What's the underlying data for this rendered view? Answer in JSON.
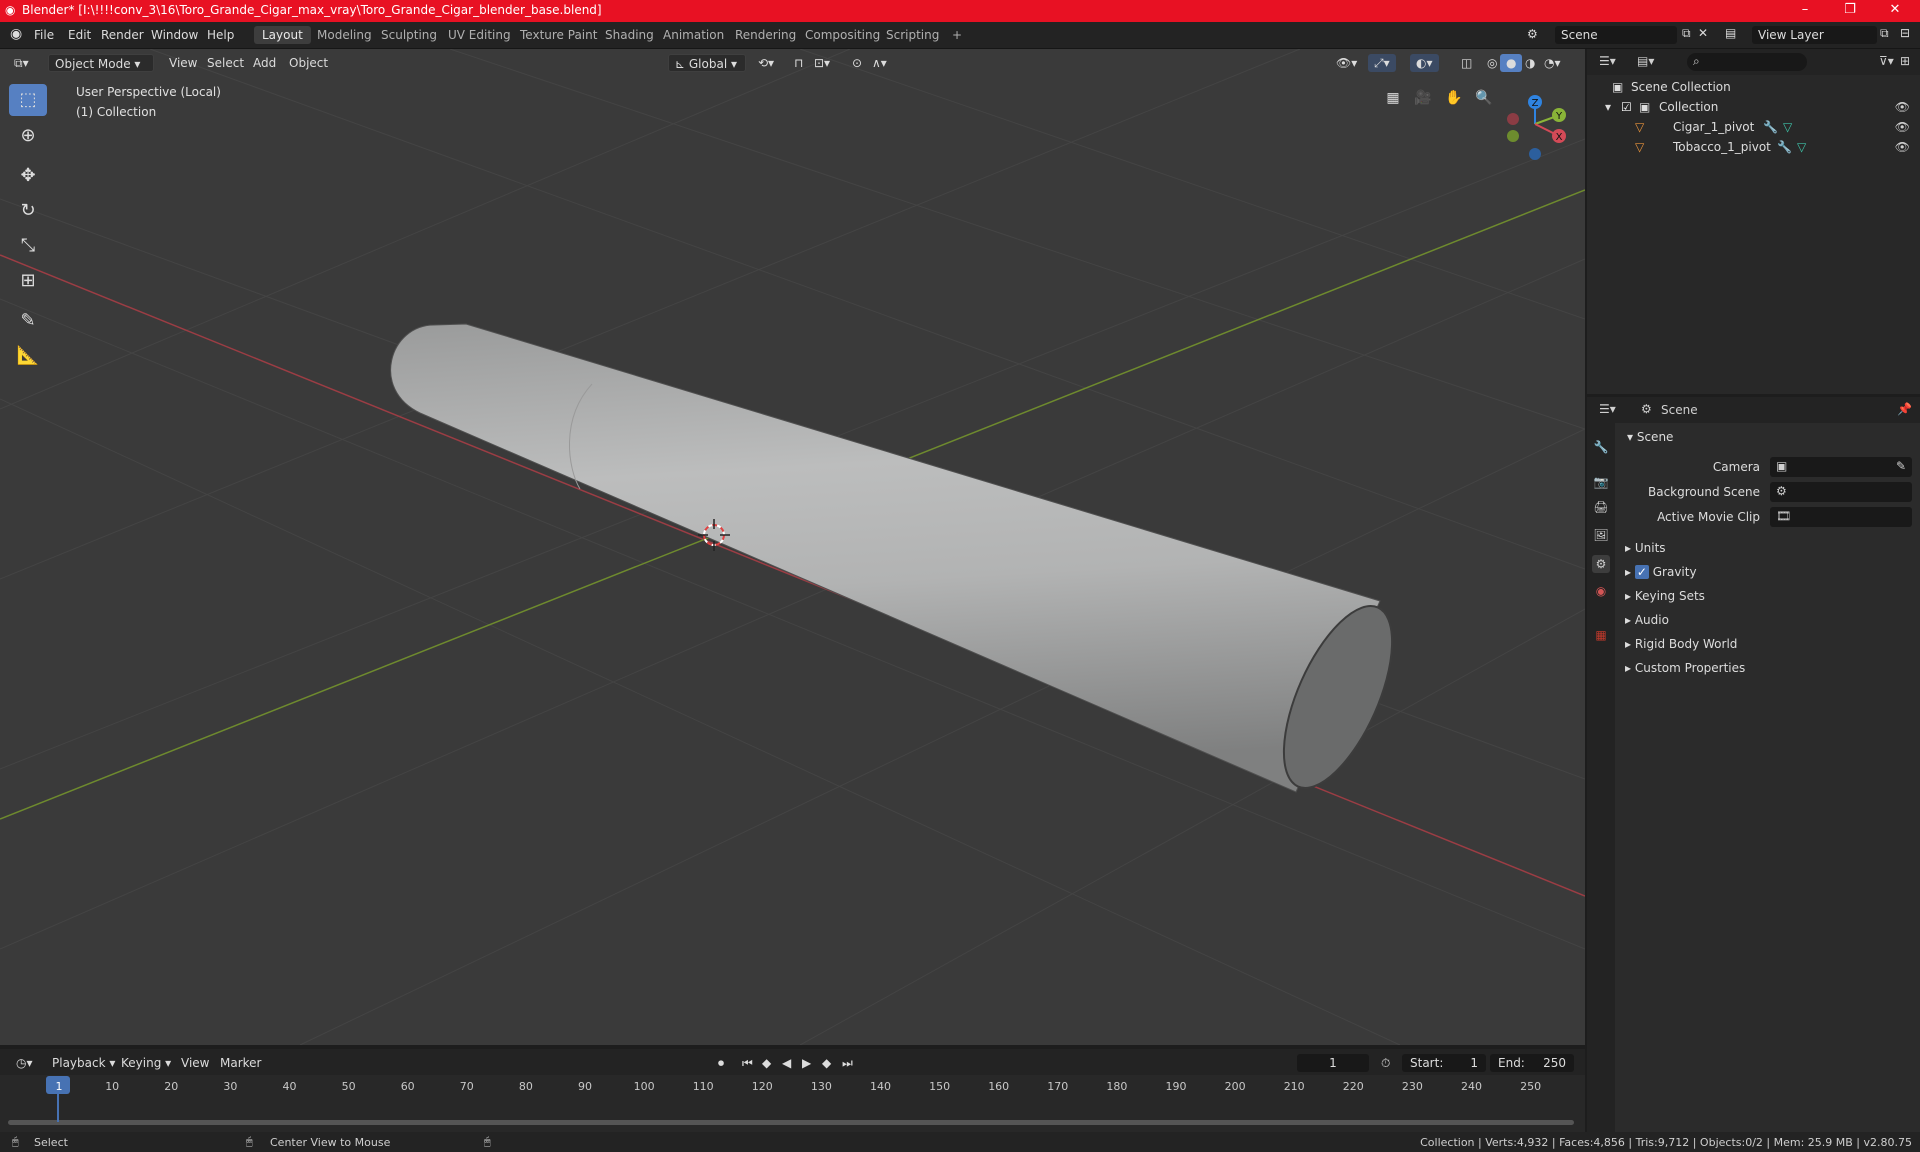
{
  "window": {
    "title": "Blender* [I:\\!!!!conv_3\\16\\Toro_Grande_Cigar_max_vray\\Toro_Grande_Cigar_blender_base.blend]",
    "minimize": "–",
    "maximize": "❐",
    "close": "✕"
  },
  "menu": [
    "File",
    "Edit",
    "Render",
    "Window",
    "Help"
  ],
  "workspaces": [
    "Layout",
    "Modeling",
    "Sculpting",
    "UV Editing",
    "Texture Paint",
    "Shading",
    "Animation",
    "Rendering",
    "Compositing",
    "Scripting"
  ],
  "workspace_add": "+",
  "scene_name": "Scene",
  "view_layer": "View Layer",
  "viewport_header": {
    "mode": "Object Mode",
    "menus": [
      "View",
      "Select",
      "Add",
      "Object"
    ],
    "orientation": "Global"
  },
  "viewport": {
    "perspective": "User Perspective (Local)",
    "collection": "(1) Collection",
    "gizmo": {
      "z": "Z",
      "y": "Y",
      "x": "X"
    }
  },
  "outliner": {
    "root": "Scene Collection",
    "collection": "Collection",
    "items": [
      "Cigar_1_pivot",
      "Tobacco_1_pivot"
    ]
  },
  "properties": {
    "header": "Scene",
    "panel": "Scene",
    "fields": [
      {
        "label": "Camera"
      },
      {
        "label": "Background Scene"
      },
      {
        "label": "Active Movie Clip"
      }
    ],
    "sections": [
      "Units",
      "Gravity",
      "Keying Sets",
      "Audio",
      "Rigid Body World",
      "Custom Properties"
    ]
  },
  "timeline": {
    "menus": [
      "Playback",
      "Keying",
      "View",
      "Marker"
    ],
    "current_frame": "1",
    "start_label": "Start:",
    "start": "1",
    "end_label": "End:",
    "end": "250",
    "ticks": [
      "1",
      "10",
      "20",
      "30",
      "40",
      "50",
      "60",
      "70",
      "80",
      "90",
      "100",
      "110",
      "120",
      "130",
      "140",
      "150",
      "160",
      "170",
      "180",
      "190",
      "200",
      "210",
      "220",
      "230",
      "240",
      "250"
    ]
  },
  "statusbar": {
    "select": "Select",
    "center": "Center View to Mouse",
    "stats": "Collection | Verts:4,932 | Faces:4,856 | Tris:9,712 | Objects:0/2 | Mem: 25.9 MB | v2.80.75"
  },
  "colors": {
    "accent": "#5680c2",
    "title": "#e81123",
    "axis_x": "#d34a57",
    "axis_y": "#8ab438",
    "axis_z": "#2f83e0"
  }
}
